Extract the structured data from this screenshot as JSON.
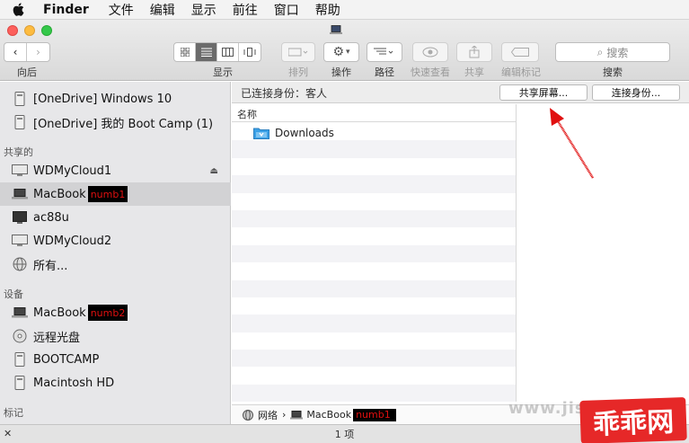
{
  "menubar": {
    "app_name": "Finder",
    "items": [
      "文件",
      "编辑",
      "显示",
      "前往",
      "窗口",
      "帮助"
    ]
  },
  "toolbar": {
    "back_forward_label": "向后",
    "view_label": "显示",
    "arrange_label": "排列",
    "action_label": "操作",
    "path_label": "路径",
    "quicklook_label": "快速查看",
    "share_label": "共享",
    "tags_label": "编辑标记",
    "search_label": "搜索",
    "search_placeholder": "搜索"
  },
  "sidebar": {
    "top_items": [
      {
        "label": "[OneDrive] Windows 10",
        "icon": "drive-icon"
      },
      {
        "label": "[OneDrive] 我的 Boot Camp (1)",
        "icon": "drive-icon"
      }
    ],
    "shared_header": "共享的",
    "shared_items": [
      {
        "label": "WDMyCloud1",
        "icon": "monitor-icon"
      },
      {
        "label": "MacBook",
        "icon": "laptop-icon",
        "redacted": "numb1"
      },
      {
        "label": "ac88u",
        "icon": "monitor-icon"
      },
      {
        "label": "WDMyCloud2",
        "icon": "monitor-icon"
      },
      {
        "label": "所有...",
        "icon": "globe-icon"
      }
    ],
    "devices_header": "设备",
    "device_items": [
      {
        "label": "MacBook",
        "icon": "laptop-icon",
        "redacted": "numb2"
      },
      {
        "label": "远程光盘",
        "icon": "disc-icon"
      },
      {
        "label": "BOOTCAMP",
        "icon": "drive-icon"
      },
      {
        "label": "Macintosh HD",
        "icon": "drive-icon"
      }
    ],
    "tags_header": "标记"
  },
  "content": {
    "connected_as": "已连接身份：客人",
    "share_screen_button": "共享屏幕...",
    "connect_as_button": "连接身份...",
    "column_name": "名称",
    "files": [
      {
        "name": "Downloads",
        "icon": "folder-icon"
      }
    ]
  },
  "pathbar": {
    "network": "网络",
    "separator": "›",
    "computer": "MacBook",
    "redacted": "numb1"
  },
  "status": {
    "item_count": "1 项"
  },
  "watermark": {
    "text": "www.jis",
    "logo": "乖乖网"
  },
  "colors": {
    "annotation_arrow": "#e01010",
    "selection": "#d2d2d4",
    "folder": "#3aa0e6"
  }
}
